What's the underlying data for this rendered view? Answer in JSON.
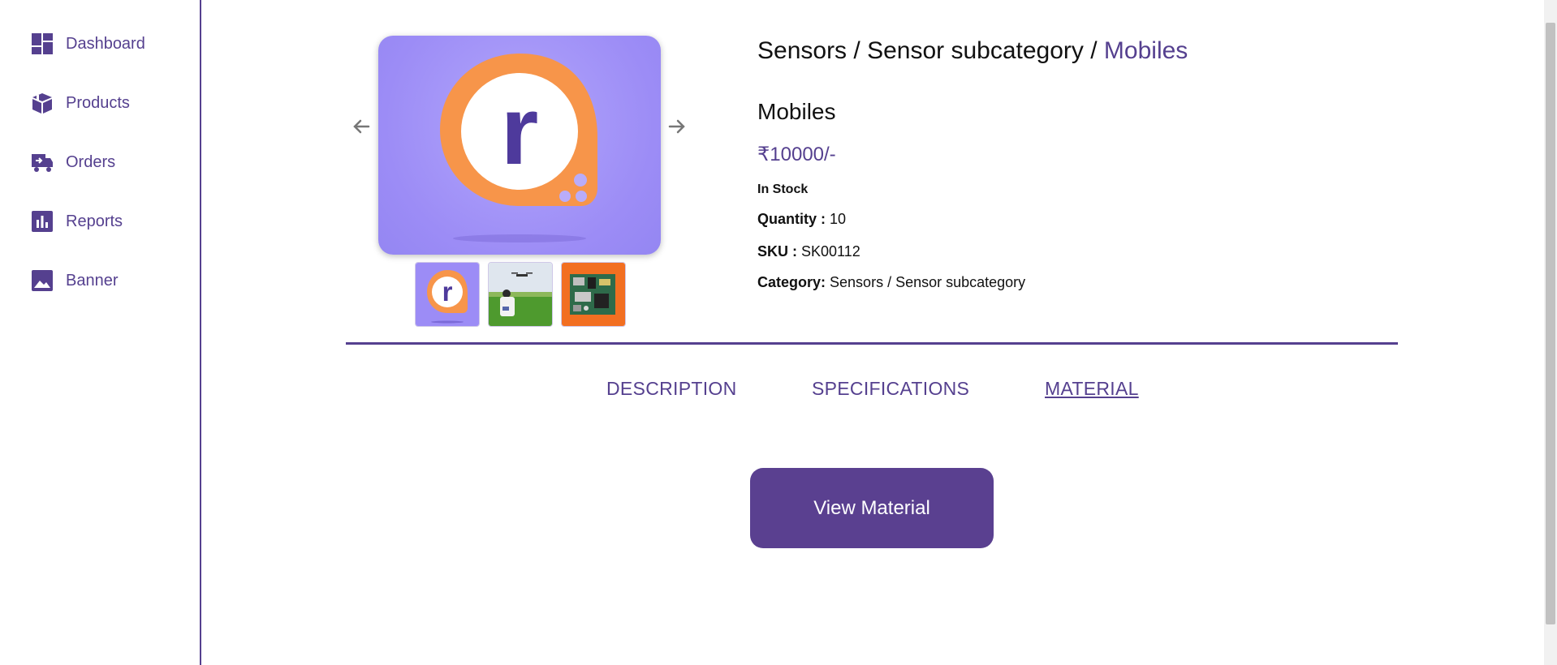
{
  "sidebar": {
    "items": [
      {
        "label": "Dashboard",
        "icon": "dashboard-icon"
      },
      {
        "label": "Products",
        "icon": "box-icon"
      },
      {
        "label": "Orders",
        "icon": "truck-icon"
      },
      {
        "label": "Reports",
        "icon": "bar-chart-icon"
      },
      {
        "label": "Banner",
        "icon": "image-icon"
      }
    ]
  },
  "product": {
    "breadcrumb": {
      "category": "Sensors",
      "sep1": " / ",
      "subcategory": "Sensor subcategory",
      "sep2": " / ",
      "current": "Mobiles"
    },
    "name": "Mobiles",
    "price": "₹10000/-",
    "stock": "In Stock",
    "quantity_label": "Quantity :",
    "quantity_value": "10",
    "sku_label": "SKU :",
    "sku_value": "SK00112",
    "category_label": "Category:",
    "category_value": "Sensors / Sensor subcategory",
    "gallery": {
      "main_image": "r-logo",
      "thumbnails": [
        "r-logo",
        "drone-field-photo",
        "circuit-board-photo"
      ]
    }
  },
  "tabs": [
    {
      "label": "DESCRIPTION",
      "active": false
    },
    {
      "label": "SPECIFICATIONS",
      "active": false
    },
    {
      "label": "MATERIAL",
      "active": true
    }
  ],
  "actions": {
    "view_material_label": "View Material"
  },
  "colors": {
    "brand": "#55408f",
    "button": "#5a4090",
    "logo_orange": "#f7954a",
    "logo_bg": "#9c8cf6"
  }
}
